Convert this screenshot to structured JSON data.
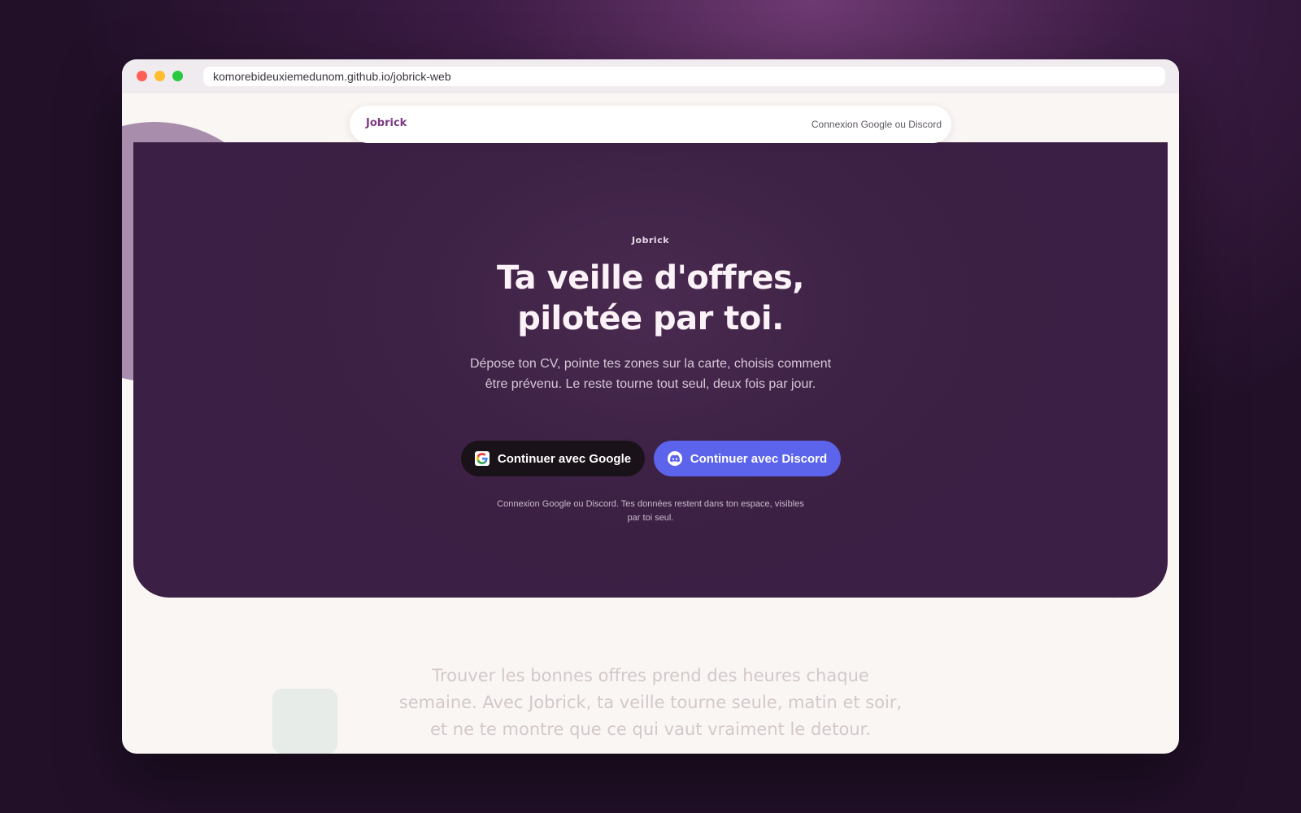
{
  "browser": {
    "url": "komorebideuxiemedunom.github.io/jobrick-web"
  },
  "navbar": {
    "brand": "Jobrick",
    "auth_hint": "Connexion Google ou Discord"
  },
  "hero": {
    "eyebrow": "Jobrick",
    "headline_line1": "Ta veille d'offres,",
    "headline_line2": "pilotée par toi.",
    "subtitle": "Dépose ton CV, pointe tes zones sur la carte, choisis comment être prévenu. Le reste tourne tout seul, deux fois par jour.",
    "google_button": "Continuer avec Google",
    "discord_button": "Continuer avec Discord",
    "fineprint": "Connexion Google ou Discord. Tes données restent dans ton espace, visibles par toi seul."
  },
  "section": {
    "intro": "Trouver les bonnes offres prend des heures chaque semaine. Avec Jobrick, ta veille tourne seule, matin et soir, et ne te montre que ce qui vaut vraiment le detour."
  },
  "colors": {
    "accent": "#7c3a82",
    "hero_bg": "#3d2245",
    "google_button_bg": "#1a1219",
    "discord_button_bg": "#5b64ea",
    "page_bg": "#faf6f3"
  },
  "icons": {
    "google": "google-icon",
    "discord": "discord-icon"
  }
}
